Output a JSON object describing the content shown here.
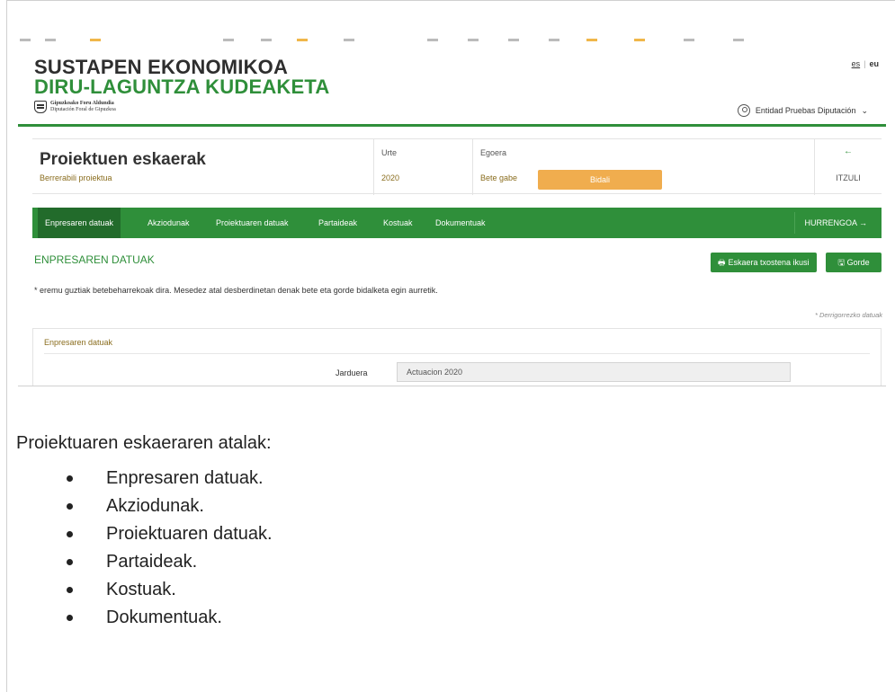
{
  "app": {
    "title_line1": "SUSTAPEN EKONOMIKOA",
    "title_line2": "DIRU-LAGUNTZA KUDEAKETA",
    "logo_line1": "Gipuzkoako Foru Aldundia",
    "logo_line2": "Diputación Foral de Gipuzkoa",
    "brand_color": "#2f8f3a",
    "accent_color": "#f0ad4e"
  },
  "lang": {
    "es": "es",
    "eu": "eu"
  },
  "user": {
    "name": "Entidad Pruebas Diputación",
    "icon": "user-icon",
    "caret": "⌄"
  },
  "project": {
    "title": "Proiektuen eskaerak",
    "subtitle": "Berrerabili proiektua",
    "year_label": "Urte",
    "year_value": "2020",
    "status_label": "Egoera",
    "status_value": "Bete gabe",
    "send_label": "Bidali",
    "back_arrow": "←",
    "back_label": "ITZULI"
  },
  "nav": {
    "items": [
      {
        "label": "Enpresaren datuak"
      },
      {
        "label": "Akziodunak"
      },
      {
        "label": "Proiektuaren datuak"
      },
      {
        "label": "Partaideak"
      },
      {
        "label": "Kostuak"
      },
      {
        "label": "Dokumentuak"
      }
    ],
    "next_label": "HURRENGOA →"
  },
  "section": {
    "heading": "ENPRESAREN DATUAK",
    "report_label": "Eskaera txostena ikusi",
    "save_label": "Gorde",
    "notice": "* eremu guztiak betebeharrekoak dira. Mesedez atal desberdinetan denak bete eta gorde bidalketa egin aurretik.",
    "required_note": "* Derrigorrezko datuak"
  },
  "panel": {
    "title": "Enpresaren datuak",
    "field_label": "Jarduera",
    "field_value": "Actuacion 2020"
  },
  "doc": {
    "heading": "Proiektuaren eskaeraren atalak:",
    "items": [
      "Enpresaren datuak.",
      "Akziodunak.",
      "Proiektuaren datuak.",
      "Partaideak.",
      "Kostuak.",
      "Dokumentuak."
    ]
  }
}
